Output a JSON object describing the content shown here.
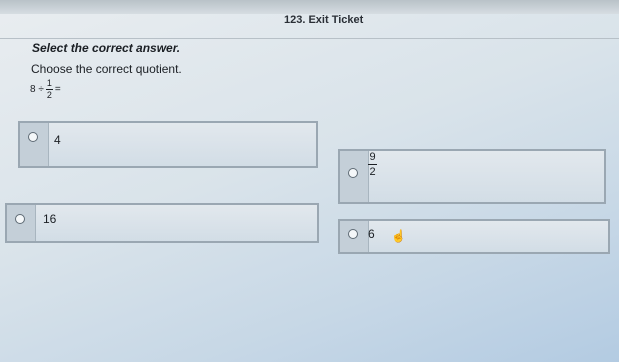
{
  "header": {
    "title": "123. Exit Ticket"
  },
  "question": {
    "instruction": "Select the correct answer.",
    "prompt": "Choose the correct quotient.",
    "equation": {
      "left": "8 ÷",
      "numerator": "1",
      "denominator": "2",
      "equals": "="
    }
  },
  "options": [
    {
      "label": "4"
    },
    {
      "numerator": "9",
      "denominator": "2"
    },
    {
      "label": "16"
    },
    {
      "label": "6"
    }
  ],
  "cursor_icon": "hand-pointer-icon"
}
